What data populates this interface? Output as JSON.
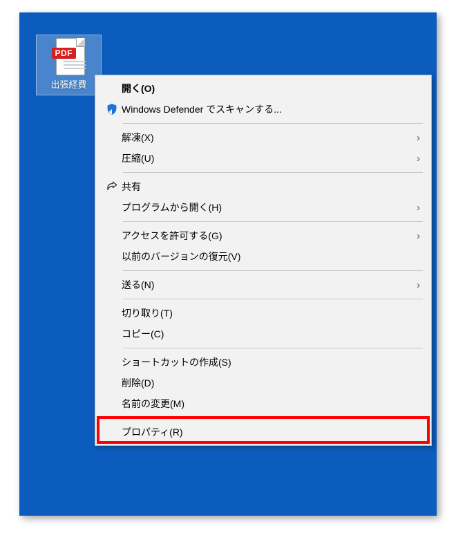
{
  "desktop": {
    "file_label": "出張経費",
    "pdf_badge": "PDF"
  },
  "menu": {
    "open": "開く(O)",
    "defender_scan": "Windows Defender でスキャンする...",
    "extract": "解凍(X)",
    "compress": "圧縮(U)",
    "share": "共有",
    "open_with": "プログラムから開く(H)",
    "grant_access": "アクセスを許可する(G)",
    "restore_previous": "以前のバージョンの復元(V)",
    "send_to": "送る(N)",
    "cut": "切り取り(T)",
    "copy": "コピー(C)",
    "create_shortcut": "ショートカットの作成(S)",
    "delete": "削除(D)",
    "rename": "名前の変更(M)",
    "properties": "プロパティ(R)"
  },
  "glyphs": {
    "submenu": "›"
  }
}
